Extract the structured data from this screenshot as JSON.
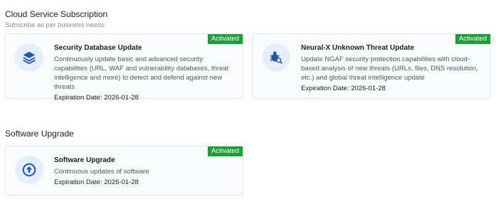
{
  "cloud_section": {
    "title": "Cloud Service Subscription",
    "subtitle": "Subscribe as per business needs"
  },
  "cards": [
    {
      "title": "Security Database Update",
      "description": "Continuously update basic and advanced security capabilities (URL, WAF and vulnerability databases, threat intelligence and more) to detect and defend against new threats",
      "expiration": "Expiration Date: 2026-01-28",
      "badge": "Activated",
      "icon": "layers-icon"
    },
    {
      "title": "Neural-X Unknown Threat Update",
      "description": "Update NGAF security protection capabilities with cloud-based analysis of new threats (URLs, files, DNS resolution, etc.) and global threat intelligence update",
      "expiration": "Expiration Date: 2026-01-28",
      "badge": "Activated",
      "icon": "bug-search-icon"
    },
    {
      "title": "Software Upgrade",
      "description": "Continuous updates of software",
      "expiration": "Expiration Date: 2026-01-28",
      "badge": "Activated",
      "icon": "upgrade-icon"
    }
  ],
  "software_section": {
    "title": "Software Upgrade"
  },
  "colors": {
    "badge": "#1f9e3b",
    "icon_primary": "#1f56b4",
    "icon_bg": "#e6eefb"
  }
}
